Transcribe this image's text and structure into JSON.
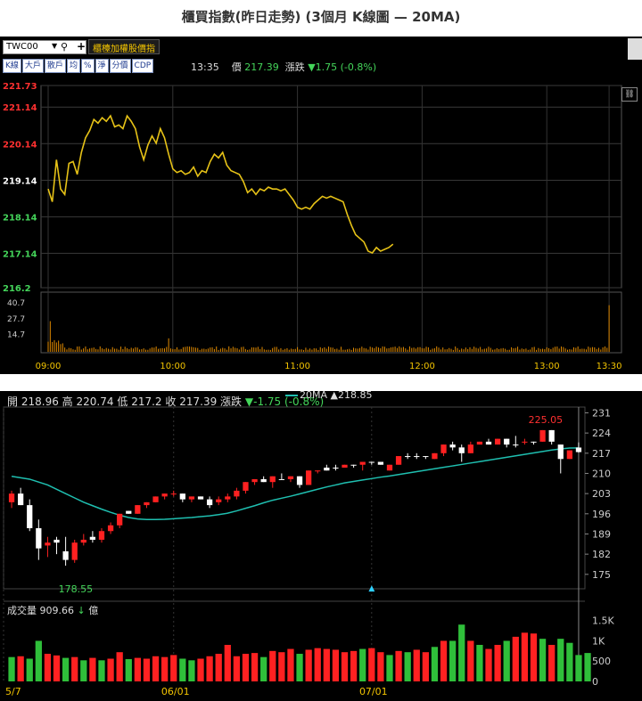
{
  "page_title": "櫃買指數(昨日走勢) (3個月 K線圖 — 20MA)",
  "colors": {
    "up": "#ff2121",
    "down": "#ffffff",
    "vol_up": "#ff2121",
    "vol_down": "#2fbf3a",
    "ma": "#1fbfb0",
    "intraday": "#e6c217",
    "bg": "#000000"
  },
  "toolbar": {
    "symbol": "TWC00",
    "mode_label": "櫃檯加權股價指",
    "buttons": [
      "K線",
      "大戶",
      "散戶",
      "均",
      "%",
      "淨",
      "分價",
      "CDP"
    ],
    "time": "13:35",
    "price_label": "價",
    "price": "217.39",
    "change_label": "漲跌",
    "change": "▼1.75 (-0.8%)"
  },
  "chart_data": [
    {
      "type": "line",
      "name": "intraday",
      "x_ticks": [
        "09:00",
        "10:00",
        "11:00",
        "12:00",
        "13:00",
        "13:30"
      ],
      "y_ticks": [
        "221.73",
        "221.14",
        "220.14",
        "219.14",
        "218.14",
        "217.14",
        "216.2"
      ],
      "y_tick_colors": [
        "#ff3030",
        "#ff3030",
        "#ff3030",
        "#ffffff",
        "#44d55a",
        "#44d55a",
        "#44d55a"
      ],
      "ylim": [
        216.2,
        221.73
      ],
      "x_minutes": [
        0,
        2,
        4,
        6,
        8,
        10,
        12,
        14,
        16,
        18,
        20,
        22,
        24,
        26,
        28,
        30,
        32,
        34,
        36,
        38,
        40,
        42,
        44,
        46,
        48,
        50,
        52,
        54,
        56,
        58,
        60,
        62,
        64,
        66,
        68,
        70,
        72,
        74,
        76,
        78,
        80,
        82,
        84,
        86,
        88,
        90,
        92,
        94,
        96,
        98,
        100,
        102,
        104,
        106,
        108,
        110,
        112,
        114,
        116,
        118,
        120,
        122,
        124,
        126,
        128,
        130,
        132,
        134,
        136,
        138,
        140,
        142,
        144,
        146,
        148,
        150,
        152,
        154,
        156,
        158,
        160,
        162,
        164,
        166,
        168,
        170,
        172,
        174,
        176,
        178,
        180,
        182,
        184,
        186,
        188,
        190,
        192,
        194,
        196,
        198,
        200,
        202,
        204,
        206,
        208,
        210,
        212,
        214,
        216,
        218,
        220,
        222,
        224,
        226,
        228,
        230,
        232,
        234,
        236,
        238,
        240,
        242,
        244,
        246,
        248,
        270
      ],
      "values": [
        218.9,
        218.55,
        219.7,
        218.9,
        218.75,
        219.6,
        219.65,
        219.3,
        219.9,
        220.3,
        220.5,
        220.8,
        220.7,
        220.85,
        220.75,
        220.9,
        220.6,
        220.65,
        220.55,
        220.9,
        220.75,
        220.55,
        220.05,
        219.7,
        220.1,
        220.35,
        220.15,
        220.55,
        220.3,
        219.85,
        219.45,
        219.35,
        219.4,
        219.3,
        219.35,
        219.5,
        219.25,
        219.4,
        219.35,
        219.65,
        219.85,
        219.75,
        219.9,
        219.55,
        219.4,
        219.35,
        219.3,
        219.1,
        218.8,
        218.9,
        218.75,
        218.9,
        218.85,
        218.95,
        218.9,
        218.9,
        218.85,
        218.9,
        218.75,
        218.6,
        218.4,
        218.35,
        218.4,
        218.35,
        218.5,
        218.6,
        218.7,
        218.65,
        218.7,
        218.65,
        218.6,
        218.55,
        218.2,
        217.9,
        217.65,
        217.55,
        217.45,
        217.2,
        217.15,
        217.3,
        217.2,
        217.25,
        217.3,
        217.39
      ],
      "vol_ticks": [
        "40.7",
        "27.7",
        "14.7"
      ],
      "vol_max": 45
    },
    {
      "type": "candlestick",
      "name": "3-month daily",
      "ohlc": {
        "open_label": "開",
        "open": "218.96",
        "high_label": "高",
        "high": "220.74",
        "low_label": "低",
        "low": "217.2",
        "close_label": "收",
        "close": "217.39",
        "change_label": "漲跌",
        "change": "▼-1.75 (-0.8%)"
      },
      "ma_label": "20MA",
      "ma_value": "▲218.85",
      "y_ticks": [
        "231",
        "224",
        "217",
        "210",
        "203",
        "196",
        "189",
        "182",
        "175"
      ],
      "ylim": [
        170,
        233
      ],
      "x_ticks": [
        "5/7",
        "06/01",
        "07/01"
      ],
      "annotations": {
        "max": "225.05",
        "min": "178.55"
      },
      "volume_label": "成交量",
      "volume_value": "909.66",
      "volume_arrow": "↓",
      "volume_unit": "億",
      "vol_ticks": [
        "1.5K",
        "1K",
        "500",
        "0"
      ],
      "vol_max": 1800,
      "candles": [
        [
          200,
          204,
          198,
          203,
          "up"
        ],
        [
          203,
          205,
          199,
          199,
          "down"
        ],
        [
          199,
          201,
          190,
          191,
          "down"
        ],
        [
          191,
          194,
          180,
          184,
          "down"
        ],
        [
          185,
          188,
          181,
          186,
          "up"
        ],
        [
          186,
          188,
          182,
          187,
          "down"
        ],
        [
          183,
          188,
          178,
          180,
          "down"
        ],
        [
          180,
          187,
          179,
          186,
          "up"
        ],
        [
          186,
          189,
          185,
          187,
          "up"
        ],
        [
          188,
          190,
          186,
          187,
          "down"
        ],
        [
          187,
          191,
          186,
          190,
          "up"
        ],
        [
          190,
          193,
          189,
          192,
          "up"
        ],
        [
          192,
          196,
          191,
          196,
          "up"
        ],
        [
          197,
          197,
          196,
          196,
          "down"
        ],
        [
          196,
          199,
          196,
          199,
          "up"
        ],
        [
          199,
          200,
          198,
          200,
          "up"
        ],
        [
          200,
          202,
          200,
          202,
          "up"
        ],
        [
          202,
          203,
          201,
          203,
          "up"
        ],
        [
          203,
          204,
          202,
          203,
          "up"
        ],
        [
          203,
          203,
          200,
          201,
          "down"
        ],
        [
          201,
          202,
          200,
          202,
          "up"
        ],
        [
          202,
          202,
          201,
          201,
          "down"
        ],
        [
          201,
          202,
          198,
          199,
          "down"
        ],
        [
          200,
          202,
          199,
          201,
          "up"
        ],
        [
          201,
          203,
          200,
          202,
          "up"
        ],
        [
          202,
          205,
          201,
          204,
          "up"
        ],
        [
          204,
          207,
          203,
          207,
          "up"
        ],
        [
          207,
          208,
          206,
          208,
          "up"
        ],
        [
          208,
          209,
          207,
          207,
          "down"
        ],
        [
          207,
          209,
          205,
          209,
          "up"
        ],
        [
          208,
          210,
          208,
          208,
          "down"
        ],
        [
          208,
          209,
          207,
          209,
          "up"
        ],
        [
          209,
          209,
          205,
          206,
          "down"
        ],
        [
          206,
          211,
          206,
          211,
          "up"
        ],
        [
          211,
          211,
          210,
          211,
          "up"
        ],
        [
          211,
          213,
          211,
          212,
          "down"
        ],
        [
          212,
          213,
          211,
          212,
          "down"
        ],
        [
          212,
          213,
          212,
          213,
          "up"
        ],
        [
          213,
          213,
          212,
          213,
          "down"
        ],
        [
          213,
          214,
          211,
          214,
          "up"
        ],
        [
          214,
          214,
          213,
          214,
          "down"
        ],
        [
          214,
          214,
          213,
          213,
          "down"
        ],
        [
          211,
          213,
          211,
          213,
          "up"
        ],
        [
          213,
          216,
          213,
          216,
          "up"
        ],
        [
          216,
          217,
          215,
          216,
          "down"
        ],
        [
          216,
          217,
          215,
          216,
          "down"
        ],
        [
          216,
          216,
          215,
          216,
          "down"
        ],
        [
          215,
          217,
          215,
          217,
          "up"
        ],
        [
          217,
          220,
          216,
          220,
          "up"
        ],
        [
          220,
          221,
          218,
          219,
          "down"
        ],
        [
          219,
          220,
          214,
          217,
          "down"
        ],
        [
          217,
          221,
          217,
          220,
          "up"
        ],
        [
          220,
          221,
          220,
          221,
          "up"
        ],
        [
          221,
          222,
          220,
          220,
          "down"
        ],
        [
          220,
          222,
          220,
          222,
          "up"
        ],
        [
          222,
          222,
          219,
          220,
          "down"
        ],
        [
          220,
          223,
          219,
          220,
          "down"
        ],
        [
          221,
          222,
          220,
          221,
          "up"
        ],
        [
          221,
          221,
          220,
          221,
          "down"
        ],
        [
          221,
          225,
          221,
          225,
          "up"
        ],
        [
          225,
          225,
          220,
          221,
          "down"
        ],
        [
          220,
          220,
          210,
          215,
          "down"
        ],
        [
          218,
          218,
          215,
          215,
          "up"
        ],
        [
          218.96,
          220.74,
          217.2,
          217.39,
          "down"
        ]
      ],
      "ma20": [
        209,
        208.5,
        208,
        207,
        206,
        204.5,
        203,
        201.5,
        200,
        198.8,
        197.6,
        196.5,
        195.5,
        194.7,
        194.2,
        194,
        194,
        194.1,
        194.3,
        194.5,
        194.7,
        195,
        195.3,
        195.7,
        196.2,
        197,
        197.9,
        198.8,
        199.8,
        200.7,
        201.4,
        202.1,
        202.9,
        203.7,
        204.5,
        205.3,
        206,
        206.7,
        207.2,
        207.7,
        208.2,
        208.7,
        209.1,
        209.6,
        210.1,
        210.6,
        211.1,
        211.6,
        212.1,
        212.6,
        213.1,
        213.6,
        214.1,
        214.6,
        215.1,
        215.6,
        216.1,
        216.6,
        217.1,
        217.6,
        218.1,
        218.5,
        218.8,
        218.85
      ],
      "volumes": [
        [
          600,
          "down"
        ],
        [
          620,
          "up"
        ],
        [
          560,
          "down"
        ],
        [
          1000,
          "down"
        ],
        [
          680,
          "up"
        ],
        [
          640,
          "up"
        ],
        [
          580,
          "down"
        ],
        [
          600,
          "up"
        ],
        [
          520,
          "down"
        ],
        [
          580,
          "up"
        ],
        [
          520,
          "down"
        ],
        [
          560,
          "up"
        ],
        [
          720,
          "up"
        ],
        [
          550,
          "down"
        ],
        [
          580,
          "up"
        ],
        [
          560,
          "up"
        ],
        [
          620,
          "up"
        ],
        [
          600,
          "up"
        ],
        [
          650,
          "up"
        ],
        [
          560,
          "down"
        ],
        [
          520,
          "down"
        ],
        [
          560,
          "up"
        ],
        [
          620,
          "up"
        ],
        [
          680,
          "up"
        ],
        [
          900,
          "up"
        ],
        [
          620,
          "up"
        ],
        [
          680,
          "up"
        ],
        [
          700,
          "up"
        ],
        [
          600,
          "down"
        ],
        [
          750,
          "up"
        ],
        [
          720,
          "up"
        ],
        [
          800,
          "up"
        ],
        [
          680,
          "down"
        ],
        [
          780,
          "up"
        ],
        [
          820,
          "up"
        ],
        [
          800,
          "up"
        ],
        [
          780,
          "up"
        ],
        [
          720,
          "up"
        ],
        [
          750,
          "up"
        ],
        [
          800,
          "down"
        ],
        [
          820,
          "up"
        ],
        [
          720,
          "up"
        ],
        [
          650,
          "down"
        ],
        [
          750,
          "up"
        ],
        [
          720,
          "down"
        ],
        [
          780,
          "up"
        ],
        [
          720,
          "up"
        ],
        [
          850,
          "down"
        ],
        [
          1000,
          "up"
        ],
        [
          1000,
          "down"
        ],
        [
          1400,
          "down"
        ],
        [
          1000,
          "up"
        ],
        [
          900,
          "down"
        ],
        [
          800,
          "up"
        ],
        [
          900,
          "up"
        ],
        [
          1000,
          "down"
        ],
        [
          1100,
          "up"
        ],
        [
          1200,
          "up"
        ],
        [
          1180,
          "up"
        ],
        [
          1050,
          "down"
        ],
        [
          900,
          "up"
        ],
        [
          1050,
          "down"
        ],
        [
          950,
          "down"
        ],
        [
          650,
          "down"
        ],
        [
          700,
          "down"
        ]
      ]
    }
  ]
}
